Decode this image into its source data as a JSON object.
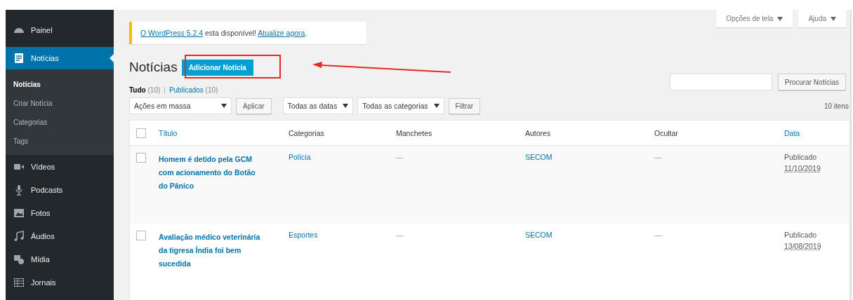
{
  "screen_options": [
    {
      "label": "Opções de tela"
    },
    {
      "label": "Ajuda"
    }
  ],
  "sidebar": {
    "items": [
      {
        "label": "Painel",
        "selected": false
      },
      {
        "label": "Notícias",
        "selected": true,
        "children": [
          {
            "label": "Notícias",
            "selected": true
          },
          {
            "label": "Criar Notícia",
            "selected": false
          },
          {
            "label": "Categorias",
            "selected": false
          },
          {
            "label": "Tags",
            "selected": false
          }
        ]
      },
      {
        "label": "Vídeos",
        "selected": false
      },
      {
        "label": "Podcasts",
        "selected": false
      },
      {
        "label": "Fotos",
        "selected": false
      },
      {
        "label": "Áudios",
        "selected": false
      },
      {
        "label": "Mídia",
        "selected": false
      },
      {
        "label": "Jornais",
        "selected": false
      }
    ]
  },
  "notice": {
    "parts": [
      {
        "kind": "link",
        "text": "O WordPress 5.2.4"
      },
      {
        "kind": "text",
        "text": " esta disponível! "
      },
      {
        "kind": "link",
        "text": "Atualize agora"
      },
      {
        "kind": "text",
        "text": "."
      }
    ]
  },
  "heading": "Notícias",
  "add_button": "Adicionar Notícia",
  "views_separator": "|",
  "views": [
    {
      "label": "Tudo",
      "count": "(10)",
      "selected": true
    },
    {
      "label": "Publicados",
      "count": "(10)",
      "selected": false
    }
  ],
  "search": {
    "button": "Procurar Notícias"
  },
  "toolbar": {
    "bulk_actions": "Ações em massa",
    "apply": "Aplicar",
    "dates": "Todas as datas",
    "categories": "Todas as categorias",
    "filter": "Filtrar",
    "count": "10 itens"
  },
  "table": {
    "select_all_checked": false,
    "columns": [
      {
        "label": "Título",
        "sortable": true
      },
      {
        "label": "Categorias",
        "sortable": false
      },
      {
        "label": "Manchetes",
        "sortable": false
      },
      {
        "label": "Autores",
        "sortable": false
      },
      {
        "label": "Ocultar",
        "sortable": false
      },
      {
        "label": "Data",
        "sortable": true
      }
    ],
    "rows": [
      {
        "checked": false,
        "title": "Homem é detido pela GCM com acionamento do Botão do Pânico",
        "category": "Polícia",
        "headline": "—",
        "author": "SECOM",
        "hidden": "—",
        "status": "Publicado",
        "date": "11/10/2019"
      },
      {
        "checked": false,
        "title": "Avaliação médico veterinária da tigresa Índia foi bem sucedida",
        "category": "Esportes",
        "headline": "—",
        "author": "SECOM",
        "hidden": "—",
        "status": "Publicado",
        "date": "13/08/2019"
      }
    ]
  }
}
